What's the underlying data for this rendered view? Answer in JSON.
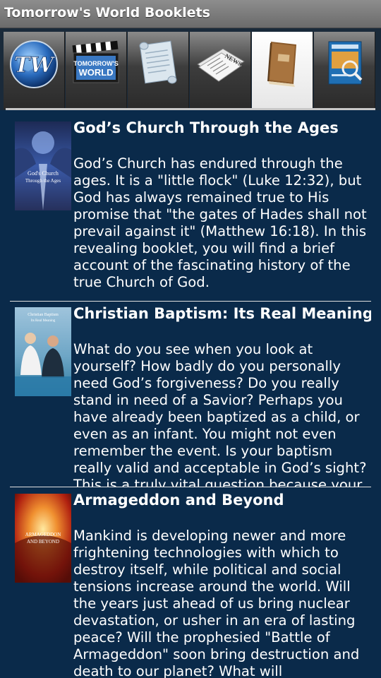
{
  "app": {
    "title": "Tomorrow's World Booklets"
  },
  "tabs": [
    {
      "icon": "tw-globe-logo-icon",
      "selected": false
    },
    {
      "icon": "tomorrows-world-clapperboard-icon",
      "selected": false,
      "label": "TOMORROW'S WORLD"
    },
    {
      "icon": "scroll-icon",
      "selected": false
    },
    {
      "icon": "newspaper-icon",
      "selected": false,
      "label": "NEWS"
    },
    {
      "icon": "book-icon",
      "selected": true
    },
    {
      "icon": "magazine-icon",
      "selected": false
    }
  ],
  "booklets": [
    {
      "title": "God’s Church Through the Ages",
      "cover_text": "God's Church Through the Ages",
      "description": "God’s Church has endured through the ages. It is a \"little flock\" (Luke 12:32), but God has always remained true to His promise that \"the gates of Hades shall not prevail against it\" (Matthew 16:18). In this revealing booklet, you will find a brief account of the fascinating history of the true Church of God."
    },
    {
      "title": "Christian Baptism: Its Real Meaning",
      "cover_text": "Christian Baptism: Its Real Meaning",
      "description": "What do you see when you look at yourself? How badly do you personally need God’s forgiveness? Do you really stand in need of a Savior? Perhaps you have already been baptized as a child, or even as an infant. You might not even remember the event. Is your baptism really valid and acceptable in God’s sight? This is a truly vital question because your very salvation depends upon"
    },
    {
      "title": "Armageddon and Beyond",
      "cover_text": "Armageddon and Beyond",
      "description": "Mankind is developing newer and more frightening technologies with which to destroy itself, while political and social tensions increase around the world. Will the years just ahead of us bring nuclear devastation, or usher in an era of lasting peace? Will the prophesied \"Battle of Armageddon\" soon bring destruction and death to our planet? What will"
    }
  ]
}
